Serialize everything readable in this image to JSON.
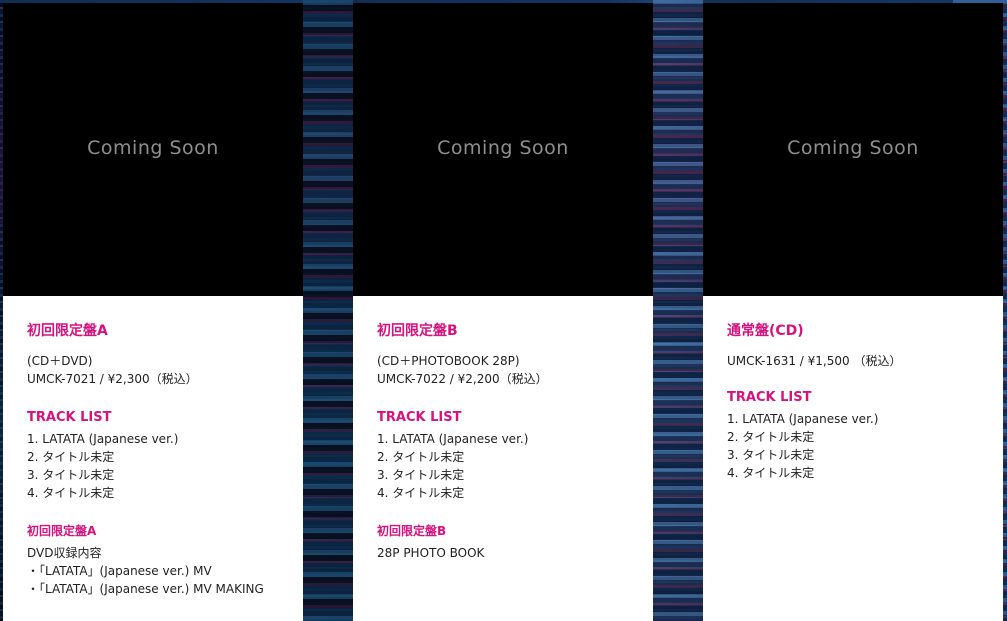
{
  "coming_soon": "Coming Soon",
  "editions": [
    {
      "title": "初回限定盤A",
      "format": "(CD＋DVD)",
      "catalog_price": "UMCK-7021 / ¥2,300（税込）",
      "tracklist_heading": "TRACK LIST",
      "tracks": [
        "1. LATATA (Japanese ver.)",
        "2. タイトル未定",
        "3. タイトル未定",
        "4. タイトル未定"
      ],
      "bonus_heading": "初回限定盤A",
      "bonus_lines": [
        "DVD収録内容",
        "・「LATATA」(Japanese ver.) MV",
        "・「LATATA」(Japanese ver.) MV MAKING"
      ]
    },
    {
      "title": "初回限定盤B",
      "format": "(CD＋PHOTOBOOK 28P)",
      "catalog_price": "UMCK-7022 / ¥2,200（税込）",
      "tracklist_heading": "TRACK LIST",
      "tracks": [
        "1. LATATA (Japanese ver.)",
        "2. タイトル未定",
        "3. タイトル未定",
        "4. タイトル未定"
      ],
      "bonus_heading": "初回限定盤B",
      "bonus_lines": [
        "28P PHOTO BOOK"
      ]
    },
    {
      "title": "通常盤(CD)",
      "catalog_price": "UMCK-1631 / ¥1,500 （税込）",
      "tracklist_heading": "TRACK LIST",
      "tracks": [
        "1. LATATA (Japanese ver.)",
        "2. タイトル未定",
        "3. タイトル未定",
        "4. タイトル未定"
      ]
    }
  ],
  "colors": {
    "accent": "#d6127f",
    "text": "#222222",
    "jacket": "#000000",
    "coming_soon_text": "#8f8f8f"
  }
}
